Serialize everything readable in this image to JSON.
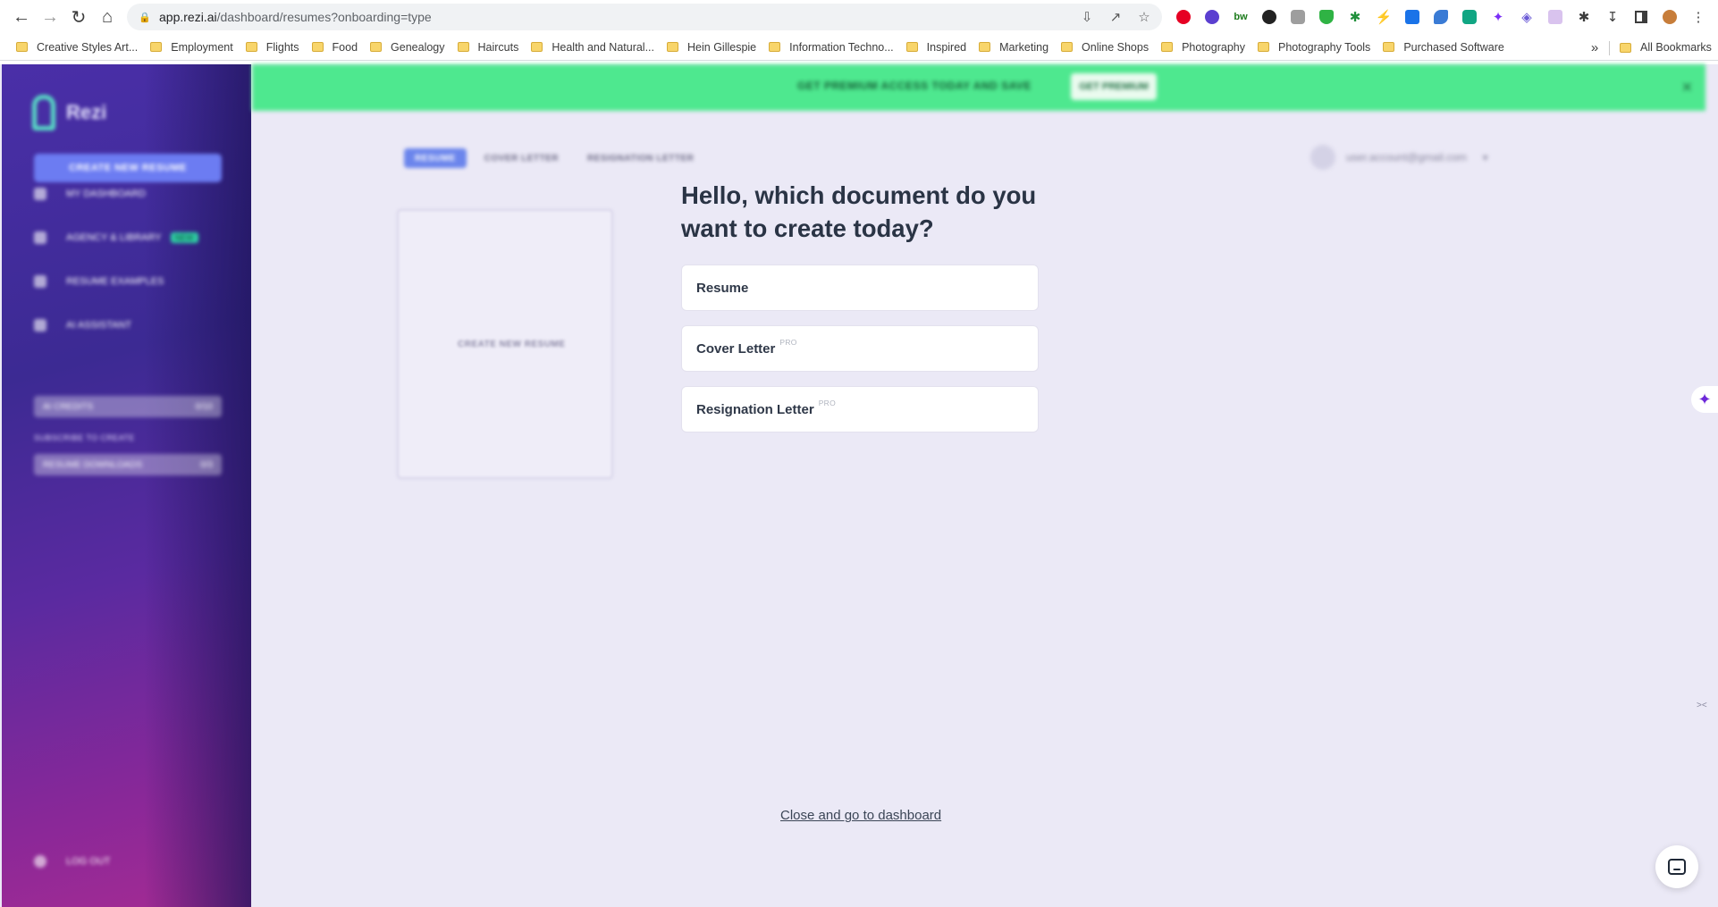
{
  "browser": {
    "url_host": "app.rezi.ai",
    "url_path": "/dashboard/resumes?onboarding=type",
    "nav": [
      "back-arrow-icon",
      "forward-arrow-icon",
      "reload-icon",
      "home-icon"
    ],
    "omnibox_icons": [
      "install-icon",
      "share-icon",
      "star-icon"
    ],
    "extensions": [
      {
        "name": "pinterest-icon",
        "color": "#e60023"
      },
      {
        "name": "circle-extension-icon",
        "color": "#5b3fd0"
      },
      {
        "name": "bw-extension-icon",
        "color": "#1a7a1a"
      },
      {
        "name": "w-extension-icon",
        "color": "#222222"
      },
      {
        "name": "gray-extension-icon",
        "color": "#9e9e9e"
      },
      {
        "name": "shield-extension-icon",
        "color": "#2fb344"
      },
      {
        "name": "puzzle-green-icon",
        "color": "#1f8f3a"
      },
      {
        "name": "lightning-extension-icon",
        "color": "#f5c518"
      },
      {
        "name": "plus-extension-icon",
        "color": "#1a73e8"
      },
      {
        "name": "leaf-extension-icon",
        "color": "#3a7bd5"
      },
      {
        "name": "grammar-extension-icon",
        "color": "#11a683"
      },
      {
        "name": "sparkle-extension-icon",
        "color": "#7b2ff7"
      },
      {
        "name": "diamond-extension-icon",
        "color": "#6b5bd6"
      },
      {
        "name": "image-extension-icon",
        "color": "#b07ad6"
      },
      {
        "name": "puzzle-icon",
        "color": "#3c3c3c"
      },
      {
        "name": "download-icon",
        "color": "#3c3c3c"
      },
      {
        "name": "side-panel-icon",
        "color": "#3c3c3c"
      },
      {
        "name": "profile-avatar-icon",
        "color": "#c77d3a"
      },
      {
        "name": "kebab-menu-icon",
        "color": "#3c3c3c"
      }
    ]
  },
  "bookmarks": {
    "items": [
      "Creative Styles Art...",
      "Employment",
      "Flights",
      "Food",
      "Genealogy",
      "Haircuts",
      "Health and Natural...",
      "Hein Gillespie",
      "Information Techno...",
      "Inspired",
      "Marketing",
      "Online Shops",
      "Photography",
      "Photography Tools",
      "Purchased Software"
    ],
    "more": "»",
    "all": "All Bookmarks"
  },
  "onboarding": {
    "question": "Hello, which document do you want to create today?",
    "options": [
      {
        "label": "Resume",
        "badge": ""
      },
      {
        "label": "Cover Letter",
        "badge": "PRO"
      },
      {
        "label": "Resignation Letter",
        "badge": "PRO"
      }
    ],
    "close_link": "Close and go to dashboard"
  },
  "colors": {
    "sidebar_gradient": [
      "#4a2fa8",
      "#a52b93"
    ],
    "banner": "#4ee88f",
    "background": "#ebe9f6",
    "heading": "#2a3445"
  }
}
